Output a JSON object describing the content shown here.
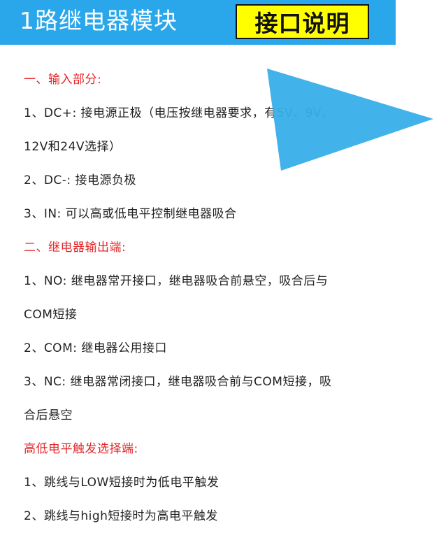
{
  "banner": {
    "title": "1路继电器模块",
    "highlight": "接口说明",
    "bg_color": "#2aa7ea",
    "highlight_color": "#ffff00"
  },
  "sections": {
    "input": {
      "heading": "一、输入部分:",
      "items": [
        "1、DC+: 接电源正极（电压按继电器要求，有5V、9V、",
        "12V和24V选择）",
        "2、DC-: 接电源负极",
        "3、IN: 可以高或低电平控制继电器吸合"
      ]
    },
    "output": {
      "heading": "二、继电器输出端:",
      "items": [
        "1、NO: 继电器常开接口，继电器吸合前悬空，吸合后与",
        "COM短接",
        "2、COM: 继电器公用接口",
        "3、NC: 继电器常闭接口，继电器吸合前与COM短接，吸",
        "合后悬空"
      ]
    },
    "trigger": {
      "heading": "高低电平触发选择端:",
      "items": [
        "1、跳线与LOW短接时为低电平触发",
        "2、跳线与high短接时为高电平触发"
      ]
    }
  },
  "colors": {
    "heading": "#e3262a",
    "text": "#222222",
    "triangle": "#38aeea"
  },
  "overlay": {
    "icon": "play-triangle-icon"
  }
}
